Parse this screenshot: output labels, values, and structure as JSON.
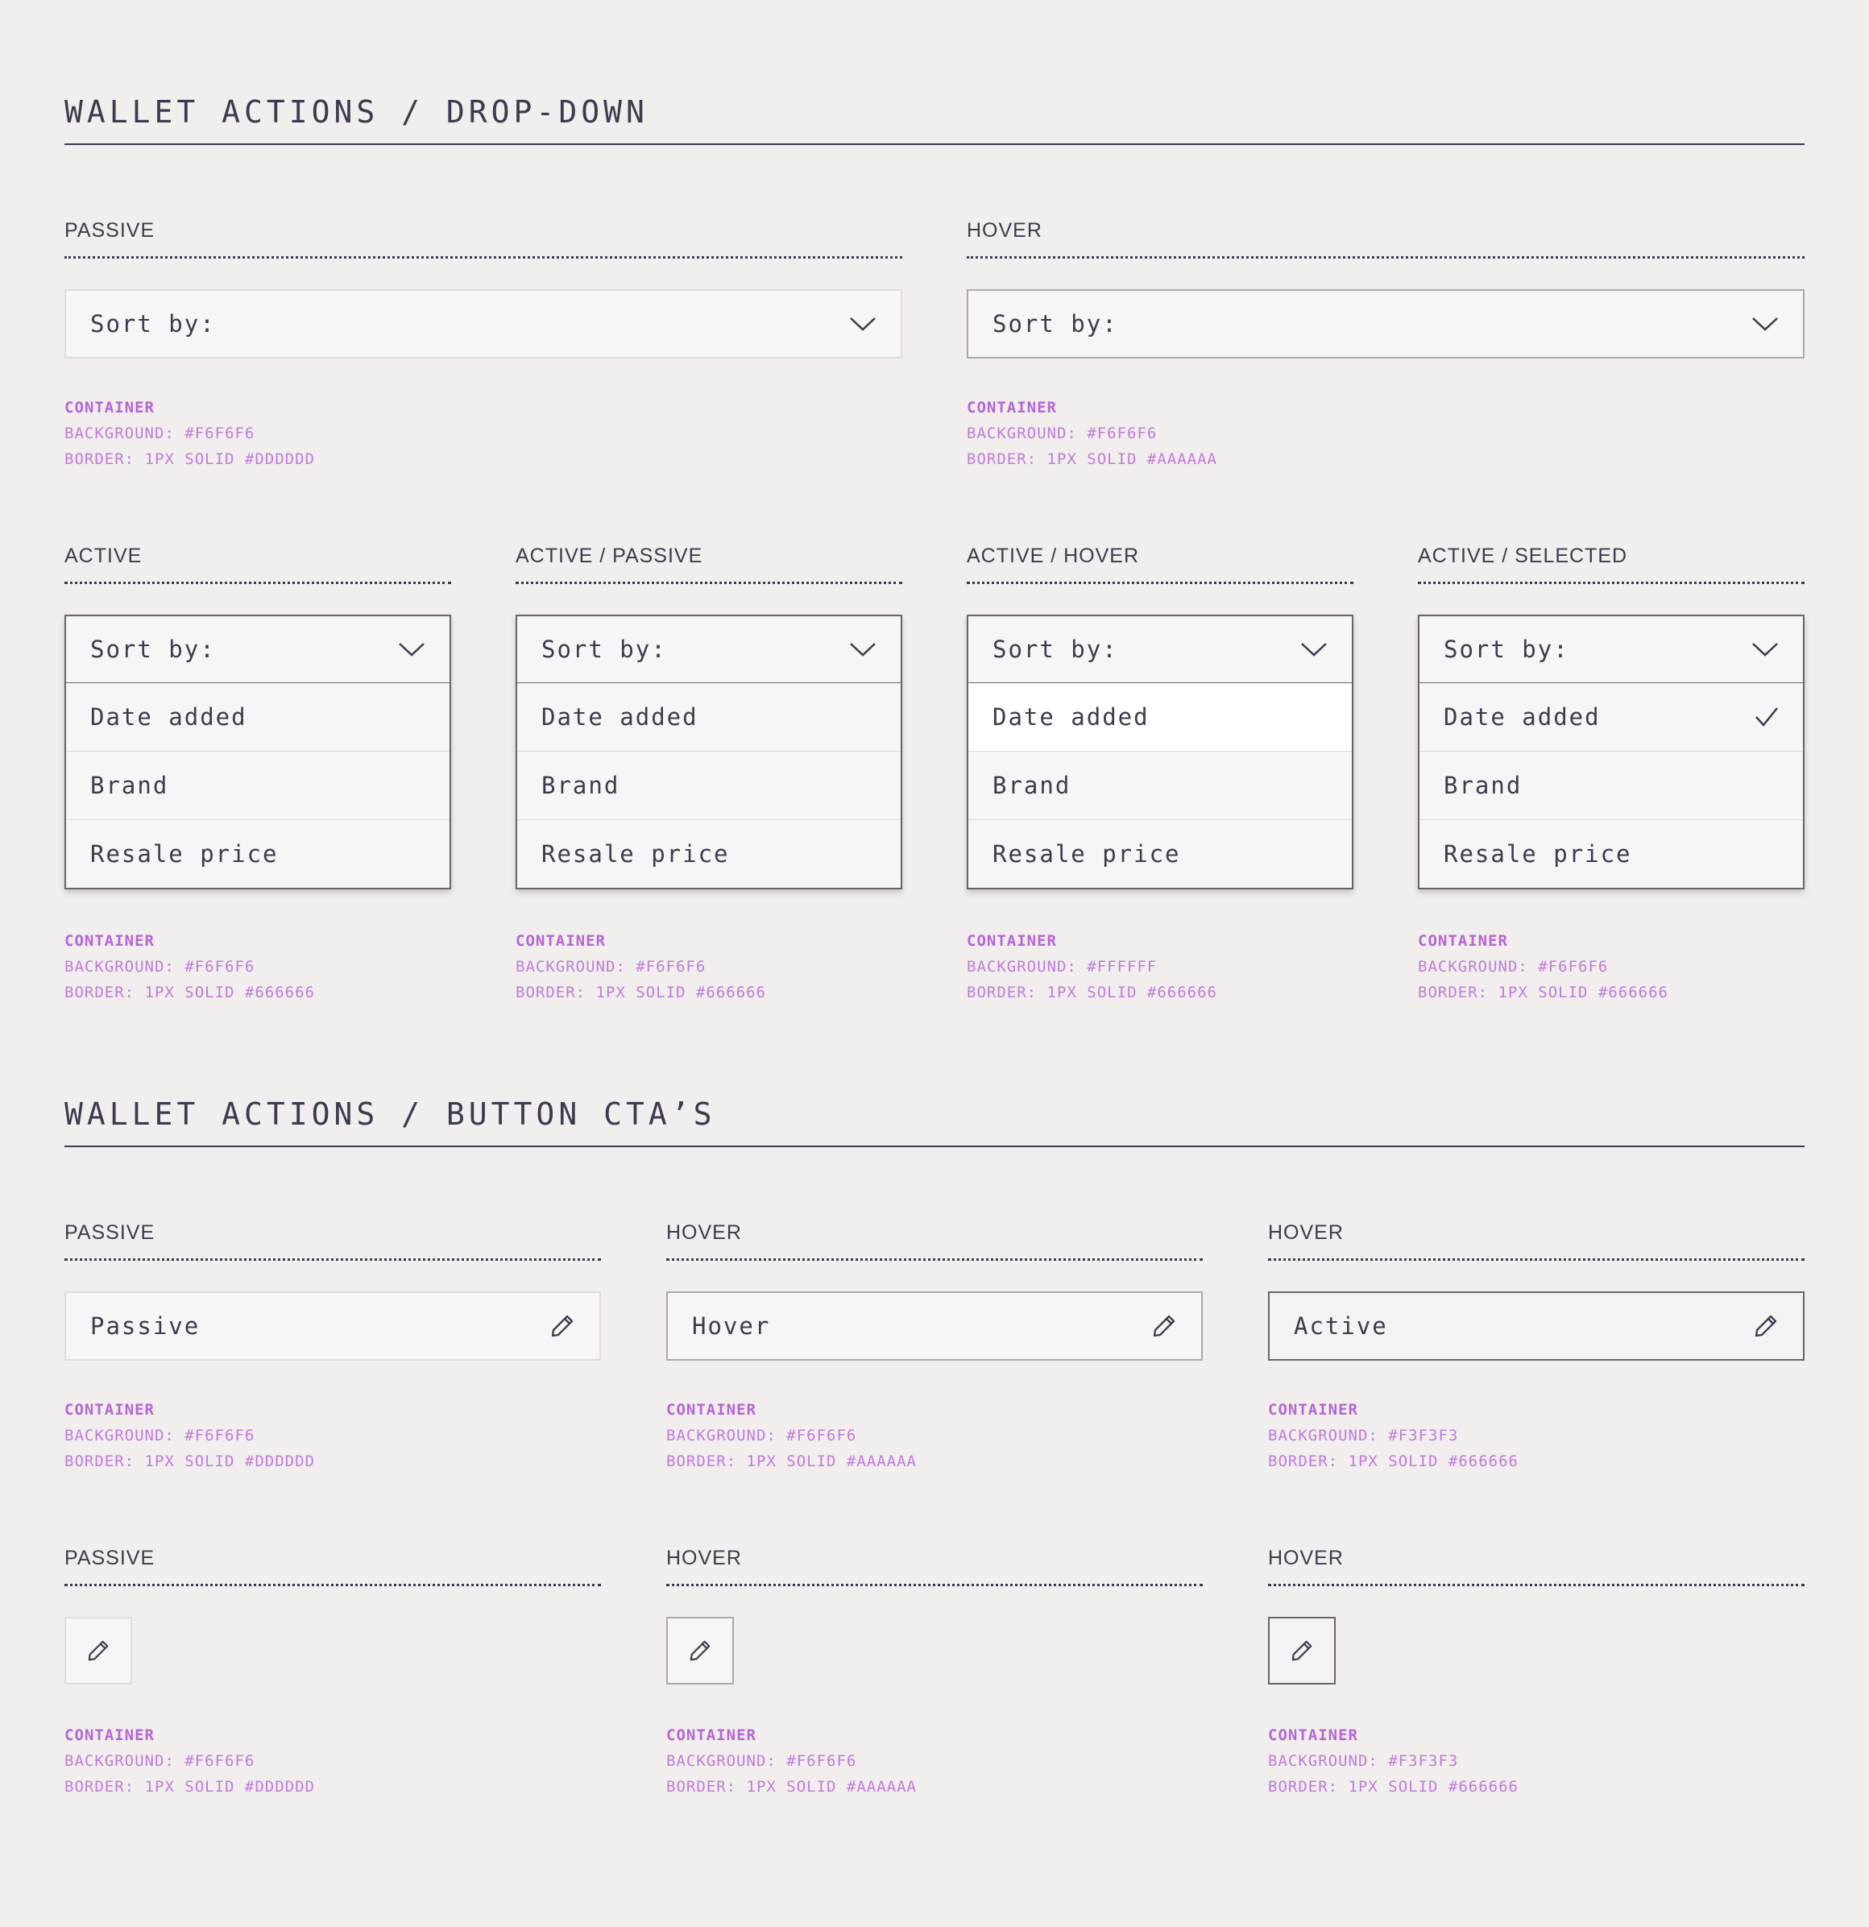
{
  "dropdown_section": {
    "title": "WALLET ACTIONS / DROP-DOWN",
    "closed": [
      {
        "label": "PASSIVE",
        "placeholder": "Sort by:",
        "spec_title": "CONTAINER",
        "spec_bg": "BACKGROUND: #F6F6F6",
        "spec_border": "BORDER: 1PX SOLID #DDDDDD"
      },
      {
        "label": "HOVER",
        "placeholder": "Sort by:",
        "spec_title": "CONTAINER",
        "spec_bg": "BACKGROUND: #F6F6F6",
        "spec_border": "BORDER: 1PX SOLID #AAAAAA"
      }
    ],
    "open": [
      {
        "label": "ACTIVE",
        "placeholder": "Sort by:",
        "options": [
          "Date added",
          "Brand",
          "Resale price"
        ],
        "spec_title": "CONTAINER",
        "spec_bg": "BACKGROUND: #F6F6F6",
        "spec_border": "BORDER: 1PX SOLID #666666"
      },
      {
        "label": "ACTIVE / PASSIVE",
        "placeholder": "Sort by:",
        "options": [
          "Date added",
          "Brand",
          "Resale price"
        ],
        "spec_title": "CONTAINER",
        "spec_bg": "BACKGROUND: #F6F6F6",
        "spec_border": "BORDER: 1PX SOLID #666666"
      },
      {
        "label": "ACTIVE / HOVER",
        "placeholder": "Sort by:",
        "options": [
          "Date added",
          "Brand",
          "Resale price"
        ],
        "spec_title": "CONTAINER",
        "spec_bg": "BACKGROUND: #FFFFFF",
        "spec_border": "BORDER: 1PX SOLID #666666"
      },
      {
        "label": "ACTIVE / SELECTED",
        "placeholder": "Sort by:",
        "options": [
          "Date added",
          "Brand",
          "Resale price"
        ],
        "spec_title": "CONTAINER",
        "spec_bg": "BACKGROUND: #F6F6F6",
        "spec_border": "BORDER: 1PX SOLID #666666"
      }
    ]
  },
  "button_section": {
    "title": "WALLET ACTIONS / BUTTON CTA’S",
    "text_buttons": [
      {
        "label": "PASSIVE",
        "text": "Passive",
        "spec_title": "CONTAINER",
        "spec_bg": "BACKGROUND: #F6F6F6",
        "spec_border": "BORDER: 1PX SOLID #DDDDDD"
      },
      {
        "label": "HOVER",
        "text": "Hover",
        "spec_title": "CONTAINER",
        "spec_bg": "BACKGROUND: #F6F6F6",
        "spec_border": "BORDER: 1PX SOLID #AAAAAA"
      },
      {
        "label": "HOVER",
        "text": "Active",
        "spec_title": "CONTAINER",
        "spec_bg": "BACKGROUND: #F3F3F3",
        "spec_border": "BORDER: 1PX SOLID #666666"
      }
    ],
    "icon_buttons": [
      {
        "label": "PASSIVE",
        "spec_title": "CONTAINER",
        "spec_bg": "BACKGROUND: #F6F6F6",
        "spec_border": "BORDER: 1PX SOLID #DDDDDD"
      },
      {
        "label": "HOVER",
        "spec_title": "CONTAINER",
        "spec_bg": "BACKGROUND: #F6F6F6",
        "spec_border": "BORDER: 1PX SOLID #AAAAAA"
      },
      {
        "label": "HOVER",
        "spec_title": "CONTAINER",
        "spec_bg": "BACKGROUND: #F3F3F3",
        "spec_border": "BORDER: 1PX SOLID #666666"
      }
    ]
  },
  "colors": {
    "page_bg": "#F1EEED",
    "text": "#3B3B4F",
    "spec_accent": "#C07BDD",
    "field_bg": "#F6F6F6",
    "field_bg_active": "#F3F3F3",
    "option_hover_bg": "#FFFFFF",
    "border_passive": "#DDDDDD",
    "border_hover": "#AAAAAA",
    "border_active": "#666666"
  },
  "icons": {
    "dropdown": "chevron-down-icon",
    "selected": "checkmark-icon",
    "edit": "pencil-icon"
  }
}
